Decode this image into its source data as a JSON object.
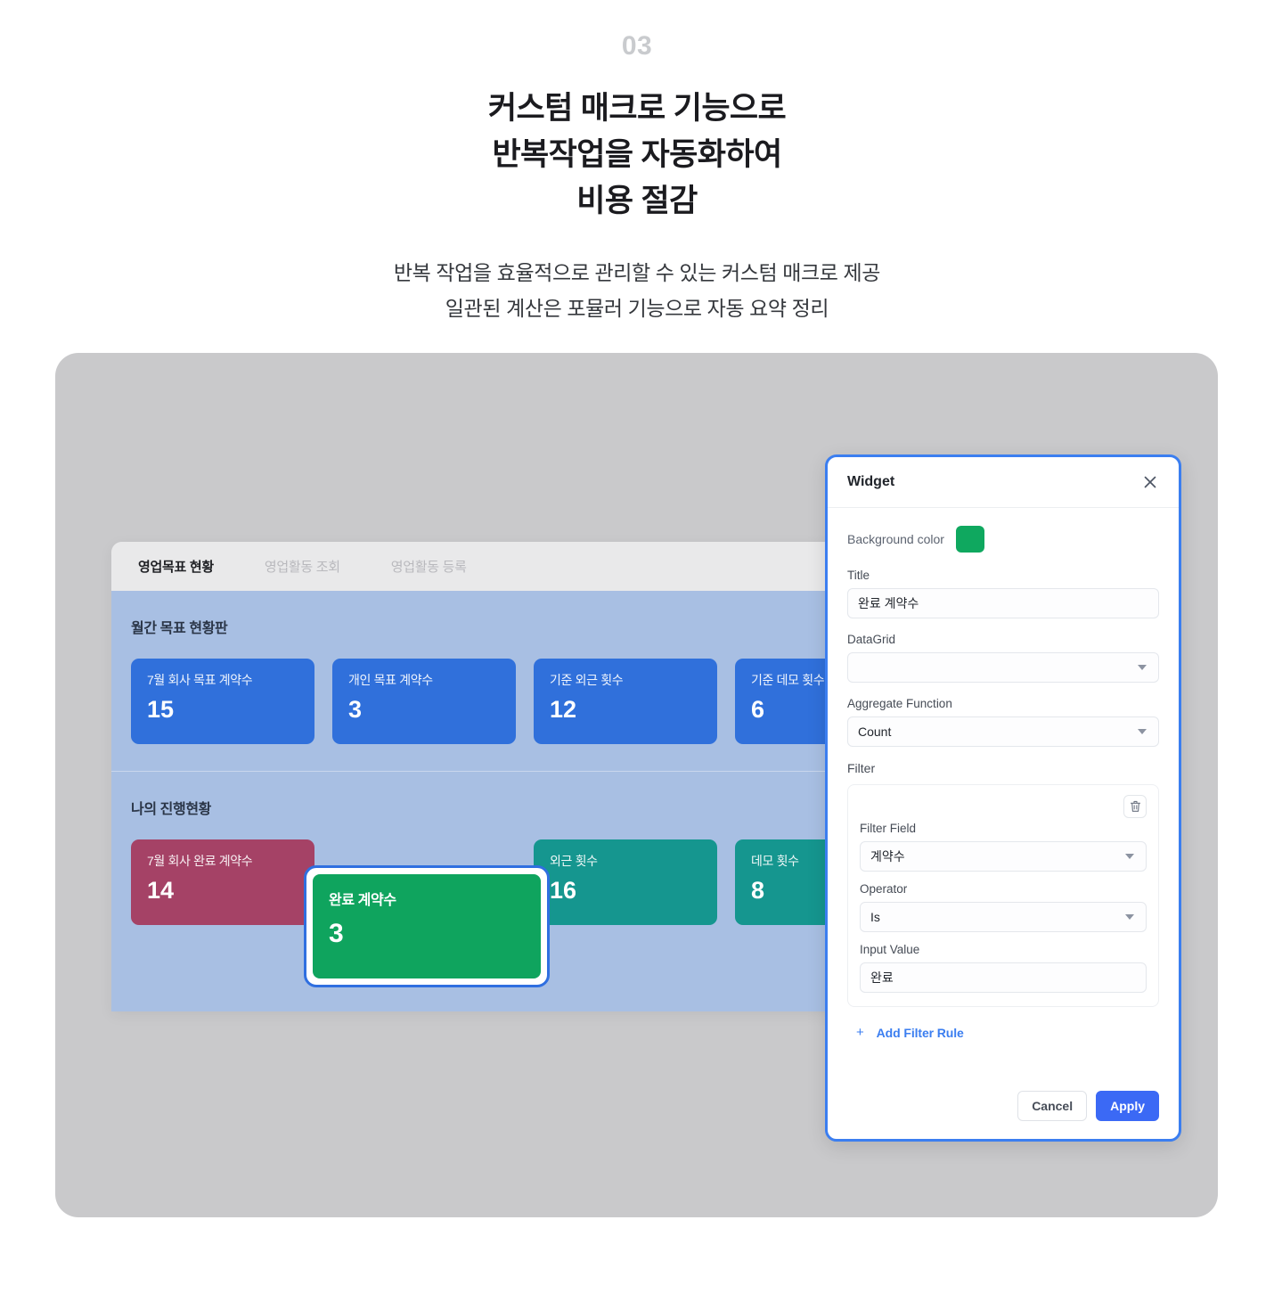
{
  "hero": {
    "number": "03",
    "title_lines": [
      "커스텀 매크로 기능으로",
      "반복작업을 자동화하여",
      "비용 절감"
    ],
    "subtitle_lines": [
      "반복 작업을 효율적으로 관리할 수 있는 커스텀 매크로 제공",
      "일관된 계산은 포뮬러 기능으로 자동 요약 정리"
    ]
  },
  "dashboard": {
    "tabs": [
      {
        "label": "영업목표 현황",
        "active": true
      },
      {
        "label": "영업활동 조회",
        "active": false
      },
      {
        "label": "영업활동 등록",
        "active": false
      }
    ],
    "sections": [
      {
        "title": "월간 목표 현황판",
        "cards": [
          {
            "label": "7월 회사 목표 계약수",
            "value": "15",
            "color": "#3070db"
          },
          {
            "label": "개인 목표 계약수",
            "value": "3",
            "color": "#3070db"
          },
          {
            "label": "기준 외근 횟수",
            "value": "12",
            "color": "#3070db"
          },
          {
            "label": "기준 데모 횟수",
            "value": "6",
            "color": "#3070db"
          }
        ]
      },
      {
        "title": "나의 진행현황",
        "cards": [
          {
            "label": "7월 회사 완료 계약수",
            "value": "14",
            "color": "#a54266"
          },
          {
            "label": "완료 계약수",
            "value": "3",
            "color": "#0fa45e"
          },
          {
            "label": "외근 횟수",
            "value": "16",
            "color": "#15968f"
          },
          {
            "label": "데모 횟수",
            "value": "8",
            "color": "#15968f"
          }
        ]
      }
    ],
    "selected_card": {
      "label": "완료 계약수",
      "value": "3",
      "color": "#0fa45e"
    }
  },
  "widget_panel": {
    "title": "Widget",
    "close_icon": "close-icon",
    "background_color": {
      "label": "Background color",
      "value": "#0fa85f"
    },
    "title_field": {
      "label": "Title",
      "value": "완료 계약수"
    },
    "datagrid_field": {
      "label": "DataGrid",
      "value": ""
    },
    "aggregate_field": {
      "label": "Aggregate Function",
      "value": "Count"
    },
    "filter": {
      "heading": "Filter",
      "delete_icon": "trash-icon",
      "filter_field": {
        "label": "Filter Field",
        "value": "계약수"
      },
      "operator": {
        "label": "Operator",
        "value": "Is"
      },
      "input_value": {
        "label": "Input Value",
        "value": "완료"
      }
    },
    "add_rule": {
      "plus": "+",
      "label": "Add Filter Rule"
    },
    "buttons": {
      "cancel": "Cancel",
      "apply": "Apply"
    },
    "accent_color": "#3b7ef0"
  }
}
